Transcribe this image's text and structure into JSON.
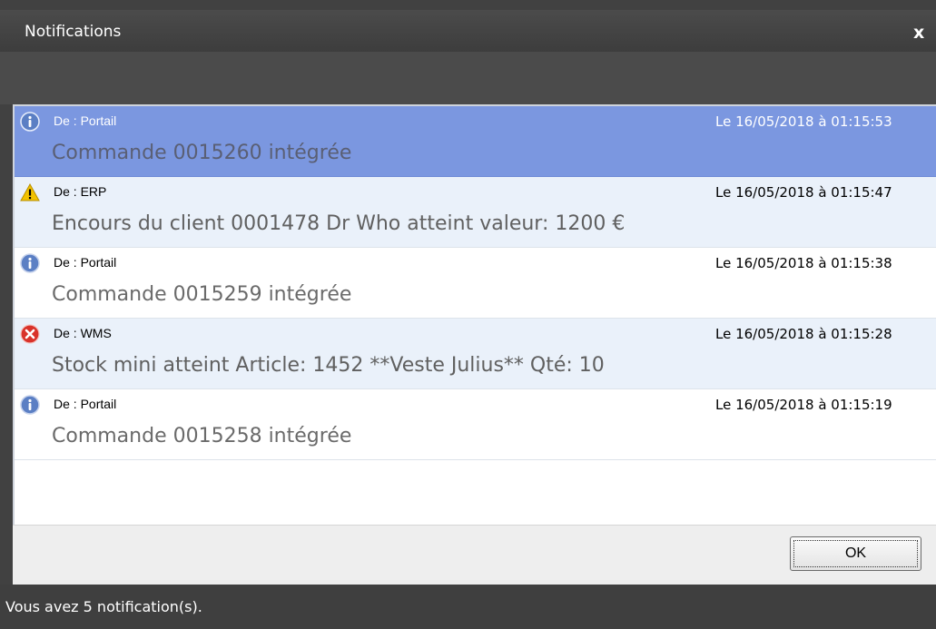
{
  "window": {
    "title": "Notifications",
    "close_label": "x"
  },
  "notifications": [
    {
      "icon": "info-icon",
      "from": "De : Portail",
      "time": "Le 16/05/2018 à 01:15:53",
      "message": "Commande 0015260 intégrée",
      "selected": true
    },
    {
      "icon": "warning-icon",
      "from": "De : ERP",
      "time": "Le 16/05/2018 à 01:15:47",
      "message": "Encours du client 0001478 Dr Who atteint valeur: 1200 €"
    },
    {
      "icon": "info-icon",
      "from": "De : Portail",
      "time": "Le 16/05/2018 à 01:15:38",
      "message": "Commande 0015259 intégrée"
    },
    {
      "icon": "error-icon",
      "from": "De : WMS",
      "time": "Le 16/05/2018 à 01:15:28",
      "message": "Stock mini atteint Article: 1452 **Veste Julius** Qté: 10"
    },
    {
      "icon": "info-icon",
      "from": "De : Portail",
      "time": "Le 16/05/2018 à 01:15:19",
      "message": "Commande 0015258 intégrée"
    }
  ],
  "footer": {
    "ok_label": "OK"
  },
  "status": {
    "text": "Vous avez 5 notification(s)."
  },
  "colors": {
    "selected_row": "#7b97e0",
    "alt_row": "#eaf1fa",
    "info": "#5b7fc4",
    "warning": "#f2c200",
    "error": "#d9322a"
  }
}
